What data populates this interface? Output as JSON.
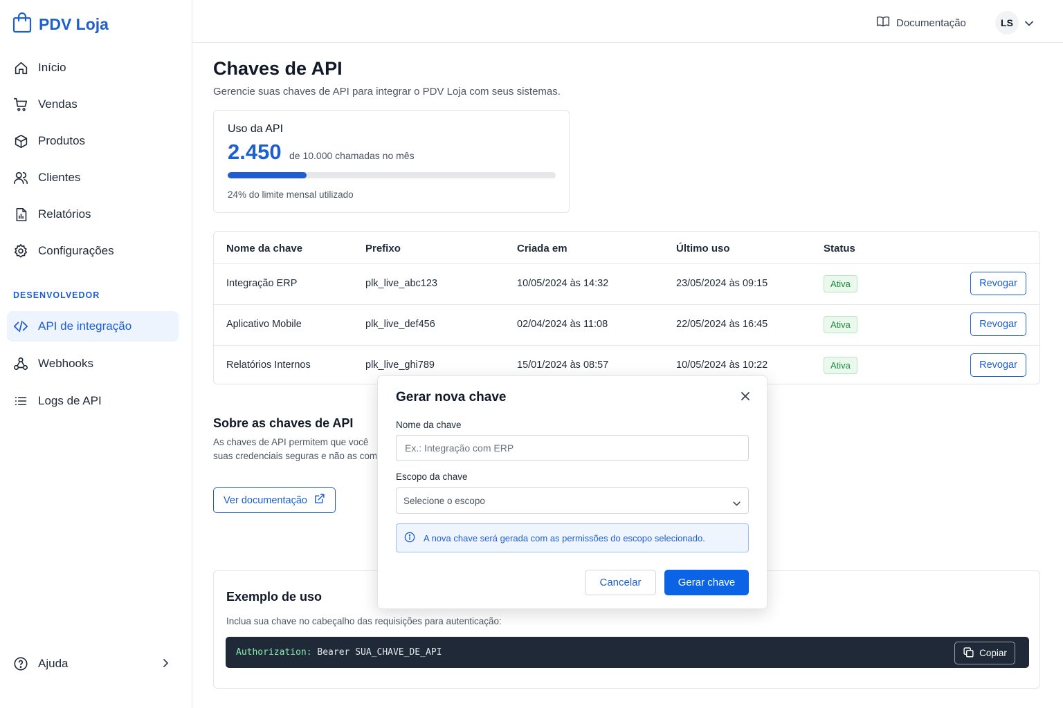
{
  "brand": {
    "name": "PDV Loja",
    "accent": "#1d5fd1"
  },
  "sidebar": {
    "items": [
      {
        "label": "Início",
        "icon": "home-icon"
      },
      {
        "label": "Vendas",
        "icon": "cart-icon"
      },
      {
        "label": "Produtos",
        "icon": "box-icon"
      },
      {
        "label": "Clientes",
        "icon": "users-icon"
      },
      {
        "label": "Relatórios",
        "icon": "report-icon"
      },
      {
        "label": "Configurações",
        "icon": "gear-icon"
      }
    ],
    "section_label": "DESENVOLVEDOR",
    "dev_items": [
      {
        "label": "API de integração",
        "icon": "code-icon",
        "active": true
      },
      {
        "label": "Webhooks",
        "icon": "webhook-icon"
      },
      {
        "label": "Logs de API",
        "icon": "list-icon"
      }
    ],
    "help_label": "Ajuda"
  },
  "header": {
    "docs_label": "Documentação",
    "avatar_initials": "LS"
  },
  "page": {
    "title": "Chaves de API",
    "subtitle": "Gerencie suas chaves de API para integrar o PDV Loja com seus sistemas."
  },
  "usage": {
    "title": "Uso da API",
    "value": "2.450",
    "of_text": "de 10.000 chamadas no mês",
    "percent": 24,
    "percent_text": "24% do limite mensal utilizado"
  },
  "keys_table": {
    "headers": [
      "Nome da chave",
      "Prefixo",
      "Criada em",
      "Último uso",
      "Status"
    ],
    "rows": [
      {
        "name": "Integração ERP",
        "prefix": "plk_live_abc123",
        "created": "10/05/2024 às 14:32",
        "last_used": "23/05/2024 às 09:15",
        "status": "Ativa",
        "action": "Revogar"
      },
      {
        "name": "Aplicativo Mobile",
        "prefix": "plk_live_def456",
        "created": "02/04/2024 às 11:08",
        "last_used": "22/05/2024 às 16:45",
        "status": "Ativa",
        "action": "Revogar"
      },
      {
        "name": "Relatórios Internos",
        "prefix": "plk_live_ghi789",
        "created": "15/01/2024 às 08:57",
        "last_used": "10/05/2024 às 10:22",
        "status": "Ativa",
        "action": "Revogar"
      }
    ]
  },
  "about": {
    "title": "Sobre as chaves de API",
    "line1": "As chaves de API permitem que você",
    "line2": "suas credenciais seguras e não as com",
    "docs_button": "Ver documentação"
  },
  "example": {
    "title": "Exemplo de uso",
    "subtitle": "Inclua sua chave no cabeçalho das requisições para autenticação:",
    "code_key": "Authorization:",
    "code_value": " Bearer SUA_CHAVE_DE_API",
    "copy_label": "Copiar"
  },
  "modal": {
    "title": "Gerar nova chave",
    "name_label": "Nome da chave",
    "name_placeholder": "Ex.: Integração com ERP",
    "scope_label": "Escopo da chave",
    "scope_placeholder": "Selecione o escopo",
    "info_text": "A nova chave será gerada com as permissões do escopo selecionado.",
    "cancel_label": "Cancelar",
    "submit_label": "Gerar chave"
  }
}
